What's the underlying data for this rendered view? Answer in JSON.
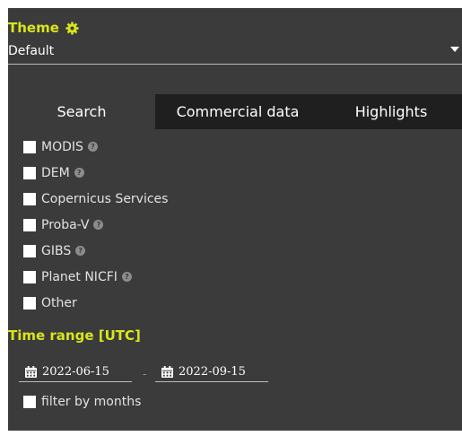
{
  "theme": {
    "label": "Theme",
    "value": "Default"
  },
  "tabs": [
    {
      "label": "Search",
      "active": true
    },
    {
      "label": "Commercial data",
      "active": false
    },
    {
      "label": "Highlights",
      "active": false
    }
  ],
  "sources": [
    {
      "label": "MODIS",
      "info": true
    },
    {
      "label": "DEM",
      "info": true
    },
    {
      "label": "Copernicus Services",
      "info": false
    },
    {
      "label": "Proba-V",
      "info": true
    },
    {
      "label": "GIBS",
      "info": true
    },
    {
      "label": "Planet NICFI",
      "info": true
    },
    {
      "label": "Other",
      "info": false
    }
  ],
  "time_range": {
    "label": "Time range [UTC]",
    "from": "2022-06-15",
    "separator": "-",
    "to": "2022-09-15",
    "filter_by_months": "filter by months"
  },
  "icons": {
    "theme": "gear-icon",
    "date": "calendar-icon",
    "info": "question-circle-icon"
  },
  "colors": {
    "accent": "#d8e61a",
    "panel": "#3b3b3b",
    "tabbar": "#1f1f1f"
  }
}
